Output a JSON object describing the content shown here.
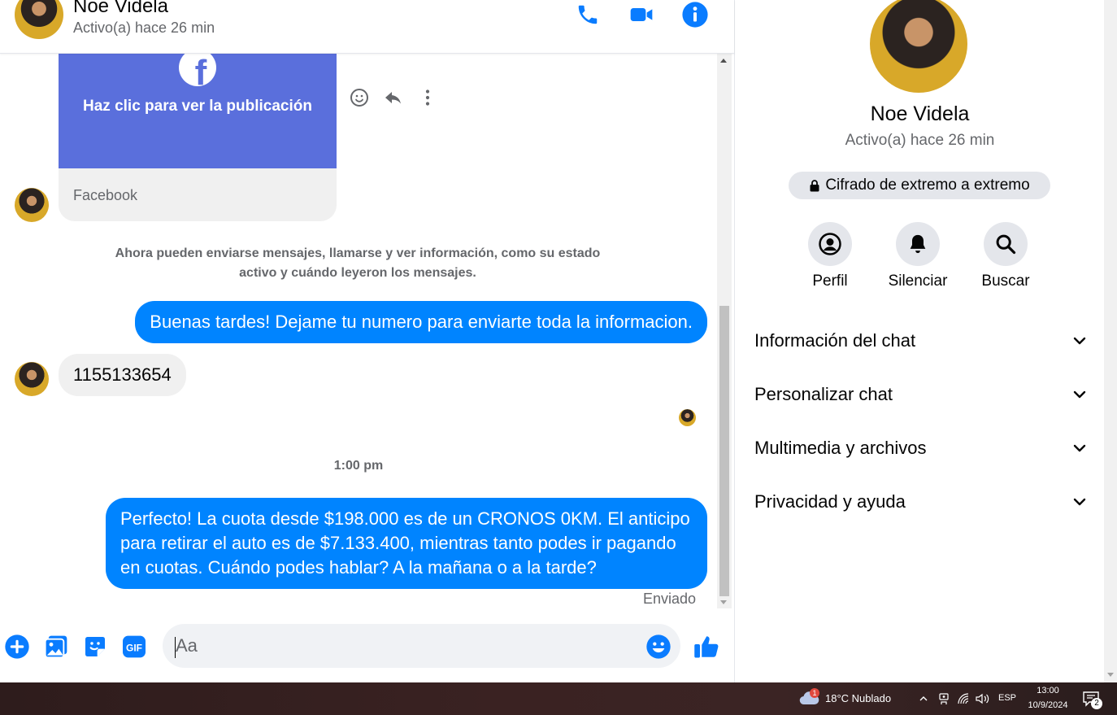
{
  "colors": {
    "accent": "#0084ff",
    "header_icon": "#0a7cff",
    "card_banner": "#5a6fdc"
  },
  "header": {
    "name": "Noe Videla",
    "status": "Activo(a) hace 26 min"
  },
  "link_card": {
    "cta": "Haz clic para ver la publicación",
    "source": "Facebook"
  },
  "system_notice": "Ahora pueden enviarse mensajes, llamarse y ver información, como su estado activo y cuándo leyeron los mensajes.",
  "messages": [
    {
      "direction": "out",
      "text": "Buenas tardes! Dejame tu numero para enviarte toda la informacion."
    },
    {
      "direction": "in",
      "text": "1155133654"
    },
    {
      "direction": "out",
      "text": "Perfecto! La cuota desde $198.000 es de un CRONOS 0KM. El anticipo para retirar el auto es de $7.133.400, mientras tanto podes ir pagando en cuotas. Cuándo podes hablar? A la mañana o a la tarde?"
    }
  ],
  "timestamp": "1:00 pm",
  "delivery_status": "Enviado",
  "composer": {
    "placeholder": "Aa",
    "gif_label": "GIF"
  },
  "panel": {
    "name": "Noe Videla",
    "status": "Activo(a) hace 26 min",
    "e2e": "Cifrado de extremo a extremo",
    "actions": [
      {
        "label": "Perfil",
        "icon": "profile-icon"
      },
      {
        "label": "Silenciar",
        "icon": "bell-icon"
      },
      {
        "label": "Buscar",
        "icon": "search-icon"
      }
    ],
    "sections": [
      "Información del chat",
      "Personalizar chat",
      "Multimedia y archivos",
      "Privacidad y ayuda"
    ]
  },
  "taskbar": {
    "weather": "18°C  Nublado",
    "weather_badge": "1",
    "lang": "ESP",
    "time": "13:00",
    "date": "10/9/2024",
    "notifications": "2"
  }
}
